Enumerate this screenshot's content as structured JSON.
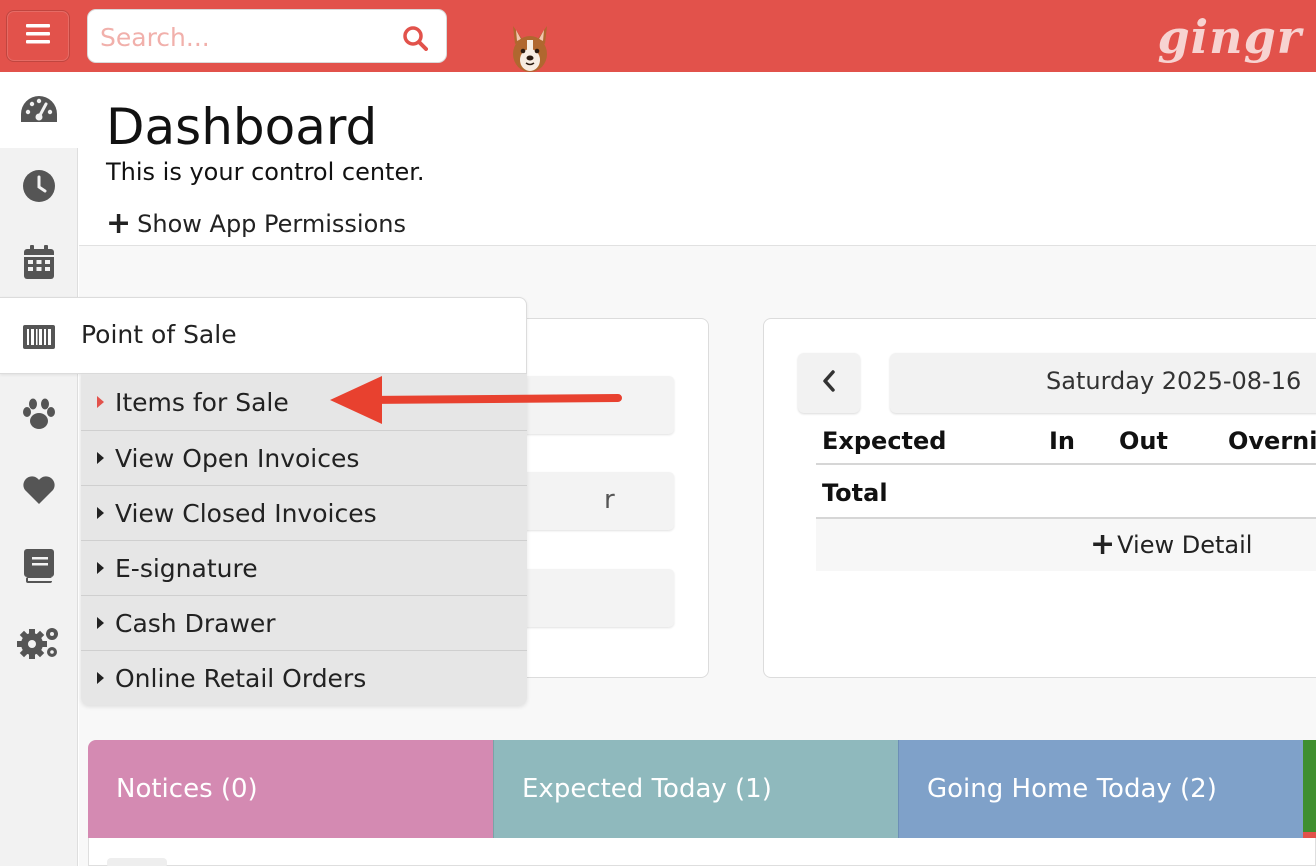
{
  "topbar": {
    "search_placeholder": "Search...",
    "logo_text": "gingr",
    "icons": [
      "hamburger-menu-icon",
      "search-icon",
      "dog-mascot-icon",
      "gingr-logo"
    ]
  },
  "sidebar": {
    "items": [
      {
        "name": "dashboard",
        "icon": "speedometer-icon"
      },
      {
        "name": "history",
        "icon": "clock-icon"
      },
      {
        "name": "calendar",
        "icon": "calendar-icon"
      },
      {
        "name": "point-of-sale",
        "icon": "barcode-icon"
      },
      {
        "name": "animals",
        "icon": "paw-icon"
      },
      {
        "name": "favorites",
        "icon": "heart-icon"
      },
      {
        "name": "reports",
        "icon": "book-icon"
      },
      {
        "name": "settings",
        "icon": "gears-icon"
      }
    ]
  },
  "header": {
    "title": "Dashboard",
    "subtitle": "This is your control center.",
    "permissions_link": "Show App Permissions"
  },
  "flyout": {
    "title": "Point of Sale",
    "items": [
      {
        "label": "Items for Sale"
      },
      {
        "label": "View Open Invoices"
      },
      {
        "label": "View Closed Invoices"
      },
      {
        "label": "E-signature"
      },
      {
        "label": "Cash Drawer"
      },
      {
        "label": "Online Retail Orders"
      }
    ]
  },
  "left_card": {
    "partial_text": "r"
  },
  "schedule": {
    "date": "Saturday 2025-08-16",
    "columns": [
      "Expected",
      "In",
      "Out",
      "Overnig"
    ],
    "total_label": "Total",
    "detail_link": "View Detail"
  },
  "tabs": [
    {
      "label": "Notices (0)",
      "color": "#d48ab2"
    },
    {
      "label": "Expected Today (1)",
      "color": "#8fb9bd"
    },
    {
      "label": "Going Home Today (2)",
      "color": "#7fa1c9"
    }
  ],
  "colors": {
    "brand_red": "#e2524b",
    "annotation_arrow": "#e8412f",
    "green_tab_edge": "#3f8f2f"
  }
}
